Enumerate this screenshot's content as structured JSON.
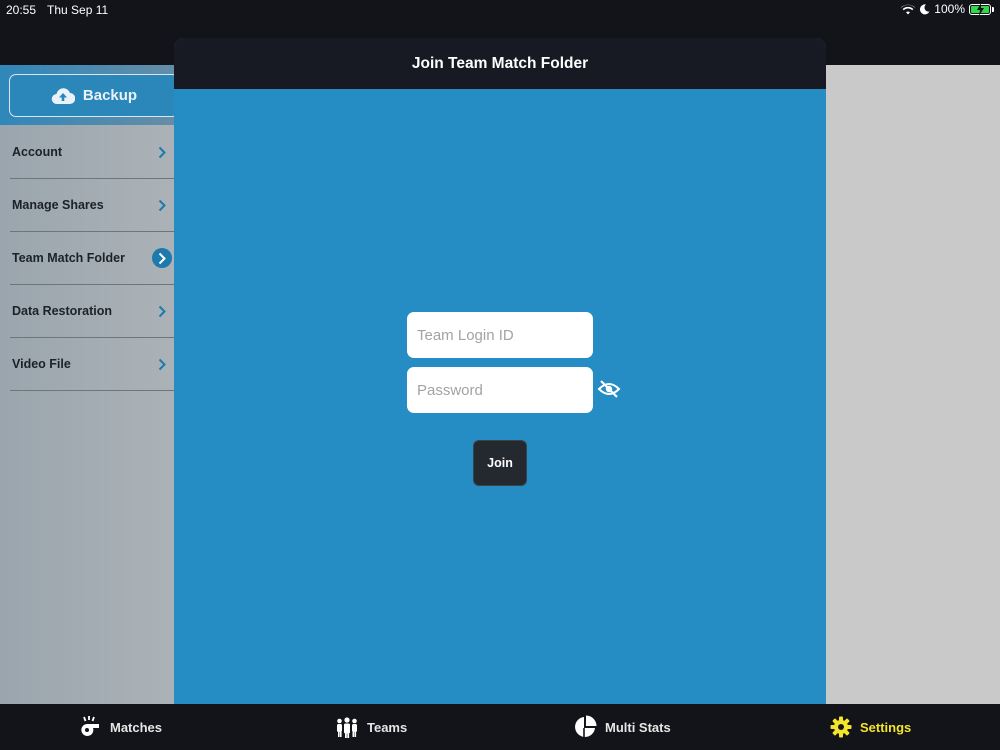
{
  "status_bar": {
    "time": "20:55",
    "date": "Thu Sep 11",
    "battery": "100%"
  },
  "sidebar": {
    "backup_label": "Backup",
    "items": [
      {
        "label": "Account",
        "selected": false
      },
      {
        "label": "Manage Shares",
        "selected": false
      },
      {
        "label": "Team Match Folder",
        "selected": true
      },
      {
        "label": "Data Restoration",
        "selected": false
      },
      {
        "label": "Video File",
        "selected": false
      }
    ]
  },
  "modal": {
    "title": "Join Team Match Folder",
    "login_id": {
      "value": "",
      "placeholder": "Team Login ID"
    },
    "password": {
      "value": "",
      "placeholder": "Password"
    },
    "join_label": "Join"
  },
  "tab_bar": {
    "tabs": [
      {
        "label": "Matches",
        "icon": "whistle-icon",
        "active": false
      },
      {
        "label": "Teams",
        "icon": "team-icon",
        "active": false
      },
      {
        "label": "Multi Stats",
        "icon": "pie-chart-icon",
        "active": false
      },
      {
        "label": "Settings",
        "icon": "gear-icon",
        "active": true
      }
    ]
  },
  "colors": {
    "modal_background": "#258dc3",
    "header_background": "#171a22",
    "active_tab": "#f3e52c",
    "battery": "#32d74b"
  }
}
